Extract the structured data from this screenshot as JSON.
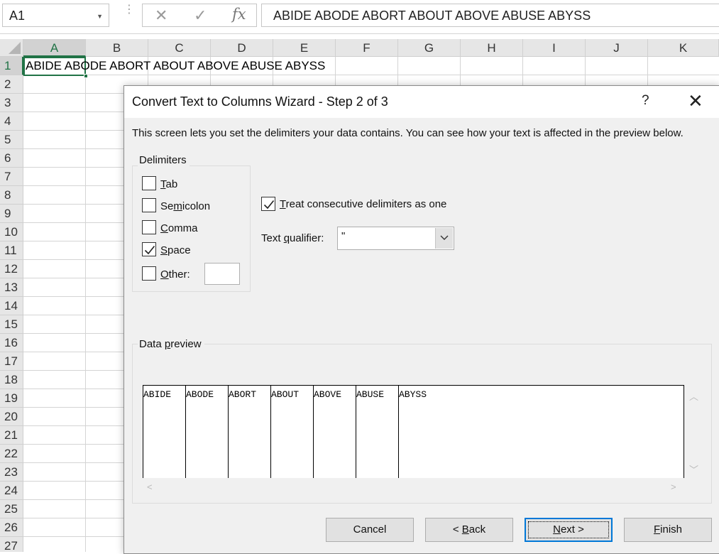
{
  "formula_bar": {
    "name_box": "A1",
    "fx": "fx",
    "formula": "ABIDE ABODE ABORT ABOUT ABOVE ABUSE ABYSS"
  },
  "sheet": {
    "columns": [
      "A",
      "B",
      "C",
      "D",
      "E",
      "F",
      "G",
      "H",
      "I",
      "J",
      "K"
    ],
    "rows": [
      "1",
      "2",
      "3",
      "4",
      "5",
      "6",
      "7",
      "8",
      "9",
      "10",
      "11",
      "12",
      "13",
      "14",
      "15",
      "16",
      "17",
      "18",
      "19",
      "20",
      "21",
      "22",
      "23",
      "24",
      "25",
      "26",
      "27"
    ],
    "selected_cell": "A1",
    "cell_a1": "ABIDE ABODE ABORT ABOUT ABOVE ABUSE ABYSS"
  },
  "dialog": {
    "title": "Convert Text to Columns Wizard - Step 2 of 3",
    "help": "?",
    "description": "This screen lets you set the delimiters your data contains.  You can see how your text is affected in the preview below.",
    "delimiters": {
      "group_label": "Delimiters",
      "tab": {
        "ul": "T",
        "rest": "ab",
        "checked": false
      },
      "semicolon": {
        "pre": "Se",
        "ul": "m",
        "rest": "icolon",
        "checked": false
      },
      "comma": {
        "ul": "C",
        "rest": "omma",
        "checked": false
      },
      "space": {
        "ul": "S",
        "rest": "pace",
        "checked": true
      },
      "other": {
        "ul": "O",
        "rest": "ther:",
        "checked": false,
        "value": ""
      }
    },
    "consecutive": {
      "ul": "T",
      "rest": "reat consecutive delimiters as one",
      "checked": true
    },
    "text_qualifier": {
      "pre": "Text ",
      "ul": "q",
      "rest": "ualifier:",
      "value": "\""
    },
    "preview": {
      "label_pre": "Data ",
      "label_ul": "p",
      "label_rest": "review",
      "columns": [
        "ABIDE",
        "ABODE",
        "ABORT",
        "ABOUT",
        "ABOVE",
        "ABUSE",
        "ABYSS"
      ]
    },
    "buttons": {
      "cancel": "Cancel",
      "back_pre": "< ",
      "back_ul": "B",
      "back_rest": "ack",
      "next_ul": "N",
      "next_rest": "ext >",
      "finish_ul": "F",
      "finish_rest": "inish"
    }
  }
}
